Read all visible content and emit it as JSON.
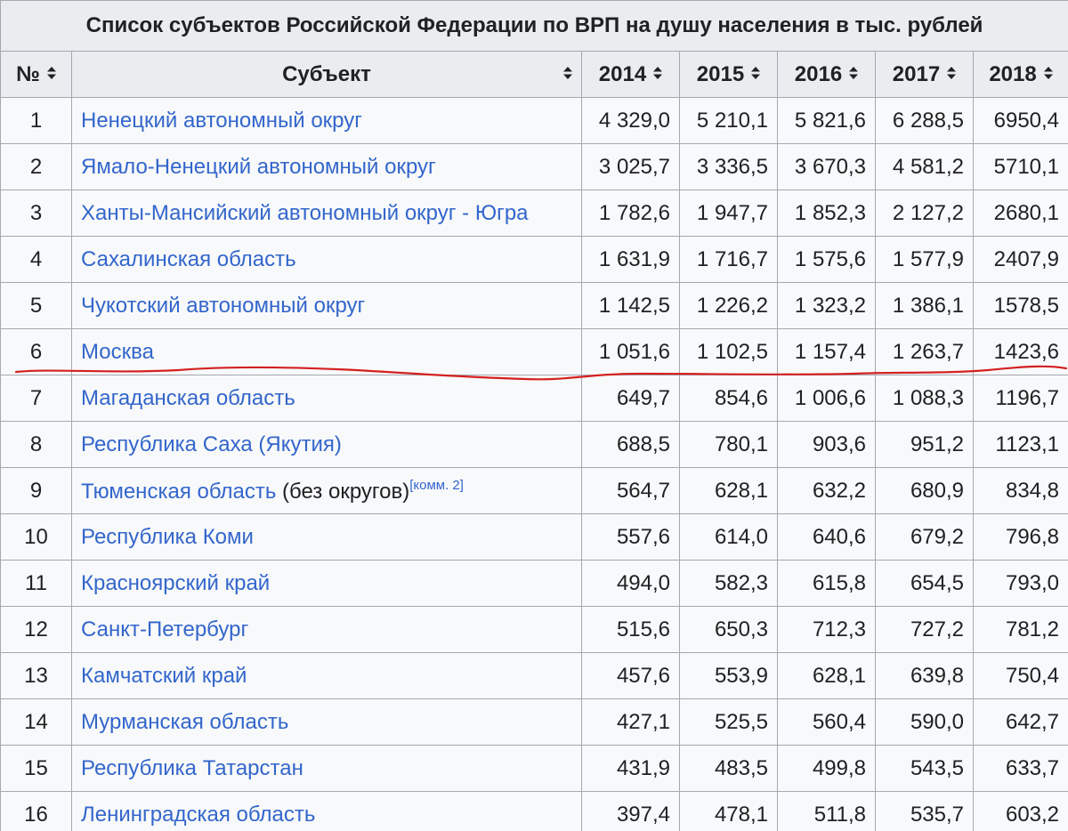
{
  "table": {
    "caption": "Список субъектов Российской Федерации по ВРП на душу населения в тыс. рублей",
    "headers": {
      "no": "№",
      "subject": "Субъект",
      "y2014": "2014",
      "y2015": "2015",
      "y2016": "2016",
      "y2017": "2017",
      "y2018": "2018"
    },
    "sort_icon": "sort-both-icon",
    "rows": [
      {
        "no": "1",
        "subject": "Ненецкий автономный округ",
        "suffix": "",
        "note": "",
        "v2014": "4 329,0",
        "v2015": "5 210,1",
        "v2016": "5 821,6",
        "v2017": "6 288,5",
        "v2018": "6950,4"
      },
      {
        "no": "2",
        "subject": "Ямало-Ненецкий автономный округ",
        "suffix": "",
        "note": "",
        "v2014": "3 025,7",
        "v2015": "3 336,5",
        "v2016": "3 670,3",
        "v2017": "4 581,2",
        "v2018": "5710,1"
      },
      {
        "no": "3",
        "subject": "Ханты-Мансийский автономный округ - Югра",
        "suffix": "",
        "note": "",
        "v2014": "1 782,6",
        "v2015": "1 947,7",
        "v2016": "1 852,3",
        "v2017": "2 127,2",
        "v2018": "2680,1"
      },
      {
        "no": "4",
        "subject": "Сахалинская область",
        "suffix": "",
        "note": "",
        "v2014": "1 631,9",
        "v2015": "1 716,7",
        "v2016": "1 575,6",
        "v2017": "1 577,9",
        "v2018": "2407,9"
      },
      {
        "no": "5",
        "subject": "Чукотский автономный округ",
        "suffix": "",
        "note": "",
        "v2014": "1 142,5",
        "v2015": "1 226,2",
        "v2016": "1 323,2",
        "v2017": "1 386,1",
        "v2018": "1578,5"
      },
      {
        "no": "6",
        "subject": "Москва",
        "suffix": "",
        "note": "",
        "v2014": "1 051,6",
        "v2015": "1 102,5",
        "v2016": "1 157,4",
        "v2017": "1 263,7",
        "v2018": "1423,6"
      },
      {
        "no": "7",
        "subject": "Магаданская область",
        "suffix": "",
        "note": "",
        "v2014": "649,7",
        "v2015": "854,6",
        "v2016": "1 006,6",
        "v2017": "1 088,3",
        "v2018": "1196,7"
      },
      {
        "no": "8",
        "subject": "Республика Саха (Якутия)",
        "suffix": "",
        "note": "",
        "v2014": "688,5",
        "v2015": "780,1",
        "v2016": "903,6",
        "v2017": "951,2",
        "v2018": "1123,1"
      },
      {
        "no": "9",
        "subject": "Тюменская область",
        "suffix": " (без округов)",
        "note": "[комм. 2]",
        "v2014": "564,7",
        "v2015": "628,1",
        "v2016": "632,2",
        "v2017": "680,9",
        "v2018": "834,8"
      },
      {
        "no": "10",
        "subject": "Республика Коми",
        "suffix": "",
        "note": "",
        "v2014": "557,6",
        "v2015": "614,0",
        "v2016": "640,6",
        "v2017": "679,2",
        "v2018": "796,8"
      },
      {
        "no": "11",
        "subject": "Красноярский край",
        "suffix": "",
        "note": "",
        "v2014": "494,0",
        "v2015": "582,3",
        "v2016": "615,8",
        "v2017": "654,5",
        "v2018": "793,0"
      },
      {
        "no": "12",
        "subject": "Санкт-Петербург",
        "suffix": "",
        "note": "",
        "v2014": "515,6",
        "v2015": "650,3",
        "v2016": "712,3",
        "v2017": "727,2",
        "v2018": "781,2"
      },
      {
        "no": "13",
        "subject": "Камчатский край",
        "suffix": "",
        "note": "",
        "v2014": "457,6",
        "v2015": "553,9",
        "v2016": "628,1",
        "v2017": "639,8",
        "v2018": "750,4"
      },
      {
        "no": "14",
        "subject": "Мурманская область",
        "suffix": "",
        "note": "",
        "v2014": "427,1",
        "v2015": "525,5",
        "v2016": "560,4",
        "v2017": "590,0",
        "v2018": "642,7"
      },
      {
        "no": "15",
        "subject": "Республика Татарстан",
        "suffix": "",
        "note": "",
        "v2014": "431,9",
        "v2015": "483,5",
        "v2016": "499,8",
        "v2017": "543,5",
        "v2018": "633,7"
      },
      {
        "no": "16",
        "subject": "Ленинградская область",
        "suffix": "",
        "note": "",
        "v2014": "397,4",
        "v2015": "478,1",
        "v2016": "511,8",
        "v2017": "535,7",
        "v2018": "603,2"
      }
    ]
  },
  "colors": {
    "link": "#3366cc",
    "header_bg": "#eaecf0",
    "cell_bg": "#f8f9fa",
    "border": "#a2a9b1",
    "annotation_line": "#d42020"
  },
  "annotation": "red-hand-drawn-underline-after-row-6"
}
